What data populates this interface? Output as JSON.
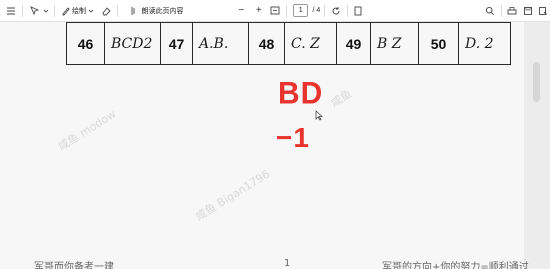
{
  "toolbar": {
    "draw_label": "绘制",
    "read_aloud_label": "朗读此页内容",
    "zoom_minus": "−",
    "zoom_plus": "+",
    "page_current": "1",
    "page_total": "/ 4"
  },
  "table": {
    "cells": [
      {
        "kind": "num",
        "text": "46"
      },
      {
        "kind": "hand",
        "text": "BCD2"
      },
      {
        "kind": "num",
        "text": "47"
      },
      {
        "kind": "hand",
        "text": "A.B."
      },
      {
        "kind": "num",
        "text": "48"
      },
      {
        "kind": "hand",
        "text": "C. Z"
      },
      {
        "kind": "num",
        "text": "49"
      },
      {
        "kind": "hand",
        "text": "B Z"
      },
      {
        "kind": "num",
        "text": "50"
      },
      {
        "kind": "hand",
        "text": "D. 2"
      }
    ]
  },
  "annotations": {
    "red_answer": "BD",
    "red_score": "−1"
  },
  "watermarks": {
    "w1": "咸鱼 modow",
    "w2": "咸鱼: ",
    "w3": "咸鱼 Bigan1796",
    "w4": "咸鱼"
  },
  "footer": {
    "left": "军哥而你备考一建",
    "page": "1",
    "right": "军哥的方向+你的努力=顺利通过"
  }
}
